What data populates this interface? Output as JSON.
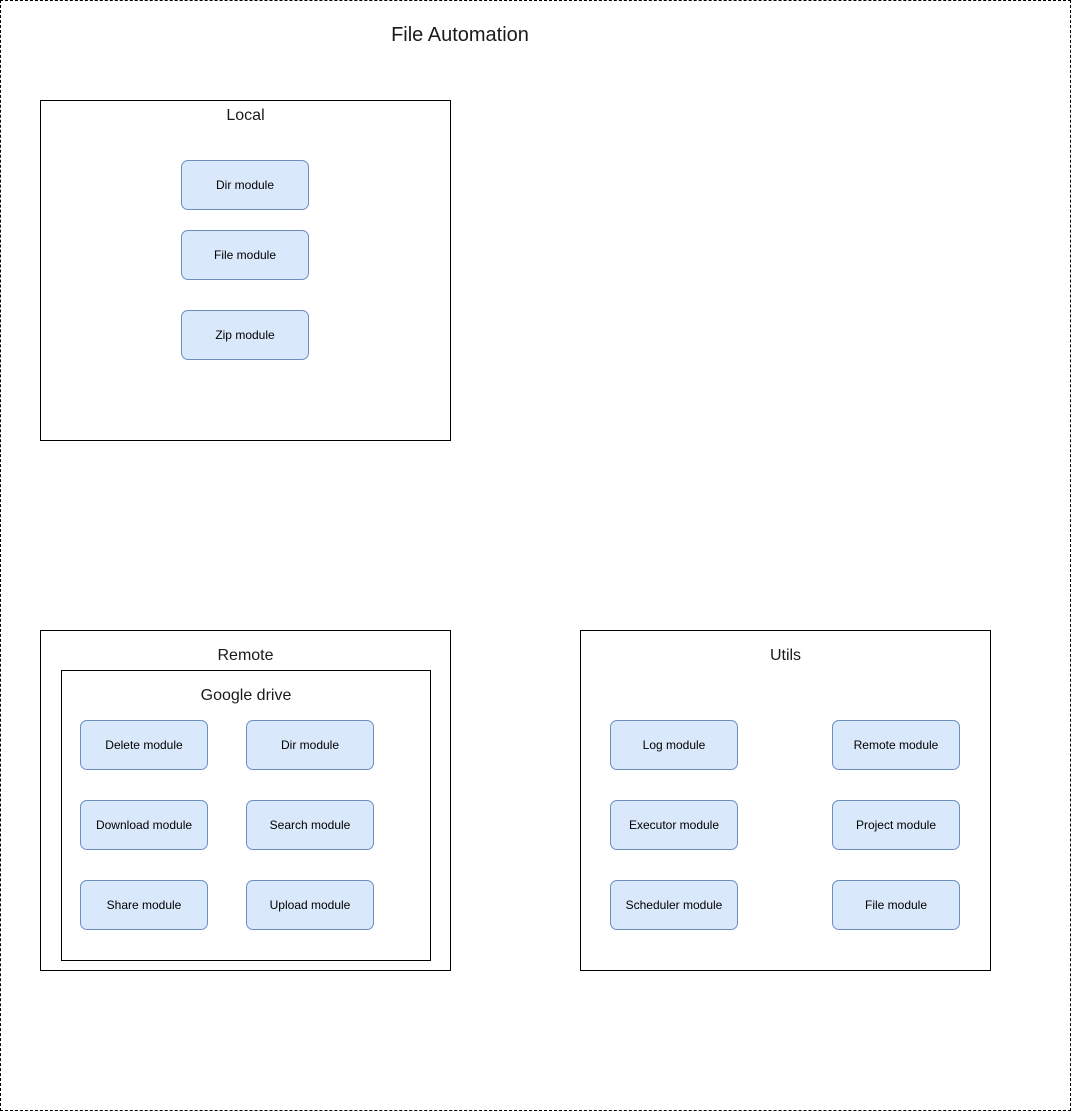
{
  "diagram": {
    "title": "File Automation",
    "colors": {
      "module_fill": "#dae8fc",
      "module_border": "#6c8ebf",
      "container_border": "#000000"
    },
    "local": {
      "label": "Local",
      "modules": [
        "Dir module",
        "File module",
        "Zip module"
      ]
    },
    "remote": {
      "label": "Remote",
      "google_drive": {
        "label": "Google drive",
        "modules": [
          "Delete module",
          "Dir module",
          "Download module",
          "Search module",
          "Share module",
          "Upload module"
        ]
      }
    },
    "utils": {
      "label": "Utils",
      "modules": [
        "Log module",
        "Remote module",
        "Executor module",
        "Project module",
        "Scheduler module",
        "File module"
      ]
    }
  }
}
